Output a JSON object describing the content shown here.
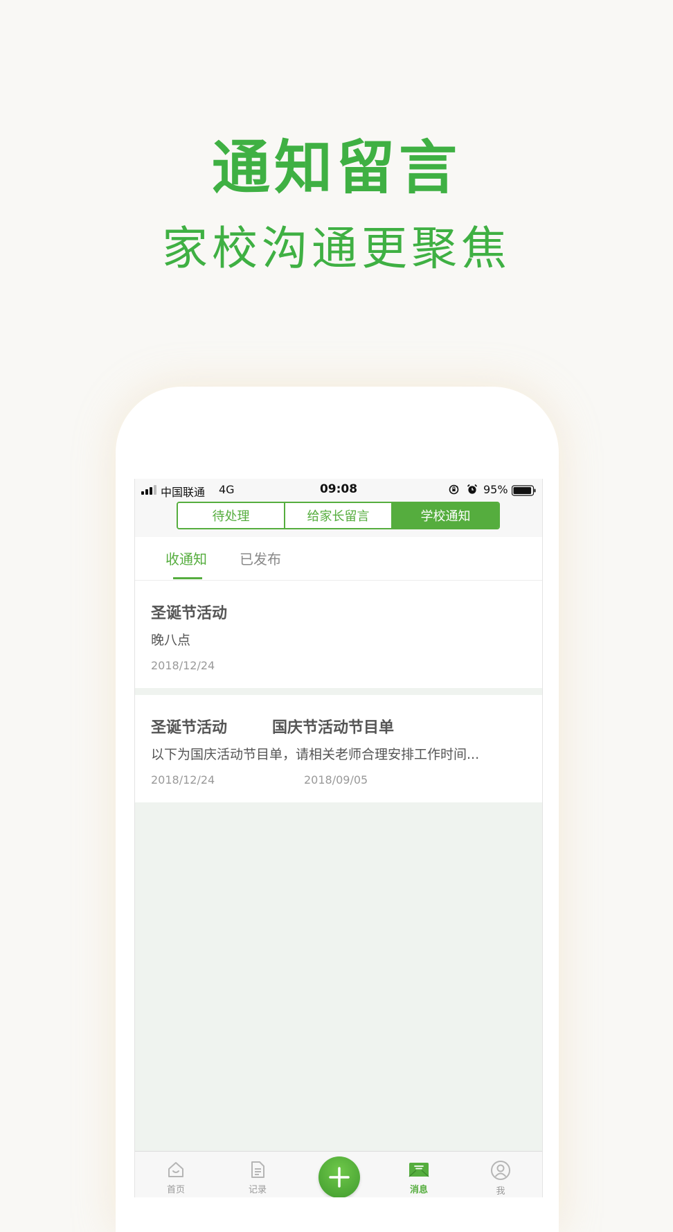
{
  "promo": {
    "headline": "通知留言",
    "subline": "家校沟通更聚焦"
  },
  "status_bar": {
    "carrier": "中国联通",
    "network": "4G",
    "time": "09:08",
    "battery_percent": "95%",
    "battery_level": 0.95
  },
  "segmented_control": {
    "segments": [
      "待处理",
      "给家长留言",
      "学校通知"
    ],
    "active_index": 2
  },
  "sub_tabs": {
    "items": [
      "收通知",
      "已发布"
    ],
    "active_index": 0
  },
  "notices": [
    {
      "title": "圣诞节活动",
      "body": "晚八点",
      "date": "2018/12/24"
    },
    {
      "title": "圣诞节活动",
      "title_overlap": "国庆节活动节目单",
      "body": "以下为国庆活动节目单，请相关老师合理安排工作时间...",
      "date": "2018/12/24",
      "date_overlap": "2018/09/05"
    }
  ],
  "bottom_nav": {
    "items": [
      {
        "label": "首页",
        "icon": "home-icon"
      },
      {
        "label": "记录",
        "icon": "document-icon"
      },
      {
        "label": "",
        "icon": "plus-icon"
      },
      {
        "label": "消息",
        "icon": "message-icon"
      },
      {
        "label": "我",
        "icon": "user-icon"
      }
    ],
    "active_index": 3
  },
  "colors": {
    "accent": "#55ad3e",
    "headline": "#3fb043",
    "page_background": "#f9f8f5",
    "list_background": "#eff3ef"
  }
}
